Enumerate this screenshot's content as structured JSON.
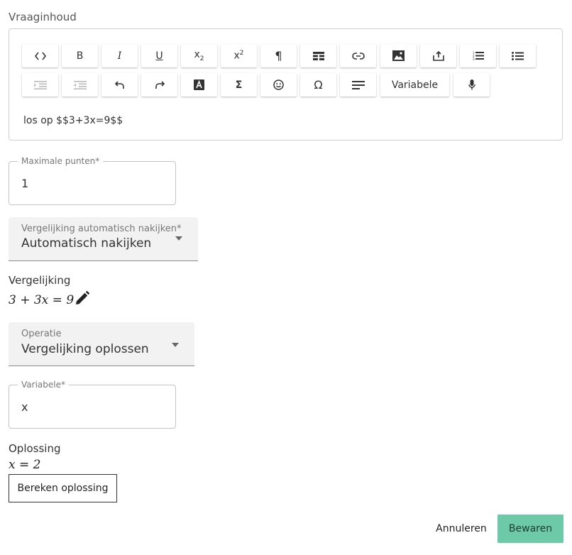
{
  "question_content": {
    "label": "Vraaginhoud",
    "content": "los op $$3+3x=9$$",
    "toolbar": {
      "variable_label": "Variabele",
      "sub_label": "x",
      "sub_index": "2",
      "sup_label": "x",
      "sup_index": "2",
      "bold": "B",
      "italic": "I",
      "underline": "U",
      "omega": "Ω",
      "sigma": "Σ"
    }
  },
  "max_points": {
    "label": "Maximale punten*",
    "value": "1"
  },
  "comparison_mode": {
    "label": "Vergelijking automatisch nakijken*",
    "value": "Automatisch nakijken"
  },
  "equation": {
    "label": "Vergelijking",
    "value": "3 + 3x = 9"
  },
  "operation": {
    "label": "Operatie",
    "value": "Vergelijking oplossen"
  },
  "variable": {
    "label": "Variabele*",
    "value": "x"
  },
  "solution": {
    "label": "Oplossing",
    "value": "x = 2",
    "compute_button": "Bereken oplossing"
  },
  "actions": {
    "cancel": "Annuleren",
    "save": "Bewaren"
  },
  "colors": {
    "primary": "#6dcaa8",
    "border": "#cfcfcf",
    "field_bg": "#f2f2f2"
  }
}
